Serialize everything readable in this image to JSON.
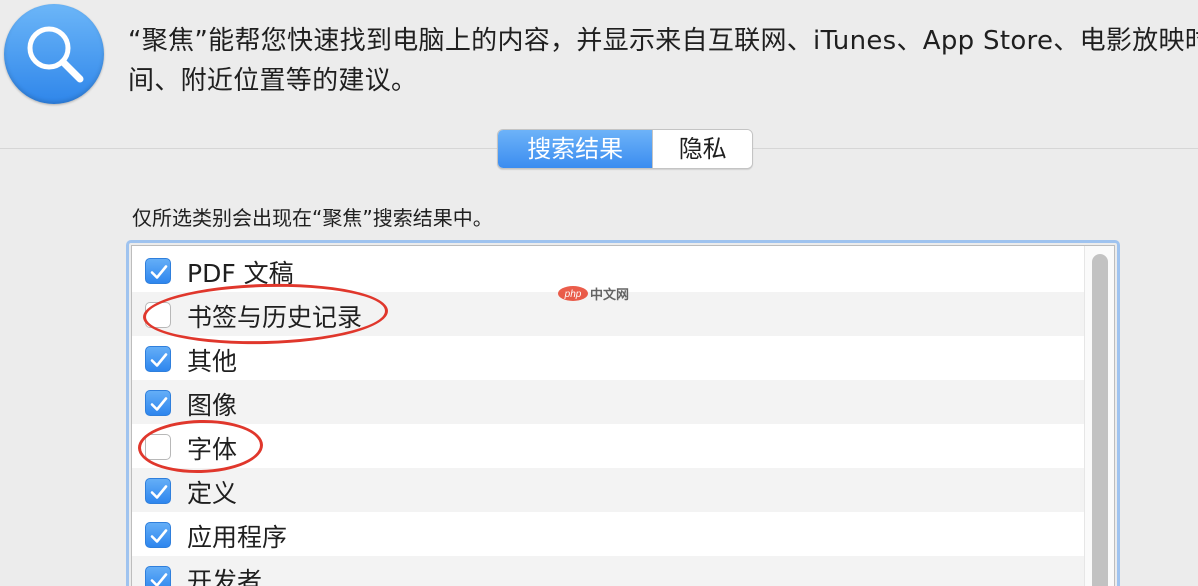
{
  "header": {
    "icon": "spotlight-magnifier-icon",
    "description_line1": "“聚焦”能帮您快速找到电脑上的内容，并显示来自互联网、iTunes、App Store、电影放映时",
    "description_line2": "间、附近位置等的建议。"
  },
  "tabs": [
    {
      "label": "搜索结果",
      "selected": true
    },
    {
      "label": "隐私",
      "selected": false
    }
  ],
  "instruction": "仅所选类别会出现在“聚焦”搜索结果中。",
  "categories": [
    {
      "label": "PDF 文稿",
      "checked": true
    },
    {
      "label": "书签与历史记录",
      "checked": false
    },
    {
      "label": "其他",
      "checked": true
    },
    {
      "label": "图像",
      "checked": true
    },
    {
      "label": "字体",
      "checked": false
    },
    {
      "label": "定义",
      "checked": true
    },
    {
      "label": "应用程序",
      "checked": true
    },
    {
      "label": "开发者",
      "checked": true
    }
  ],
  "watermark": {
    "badge": "php",
    "text": "中文网"
  },
  "colors": {
    "accent": "#3b8df0",
    "annotation": "#e0372c"
  }
}
